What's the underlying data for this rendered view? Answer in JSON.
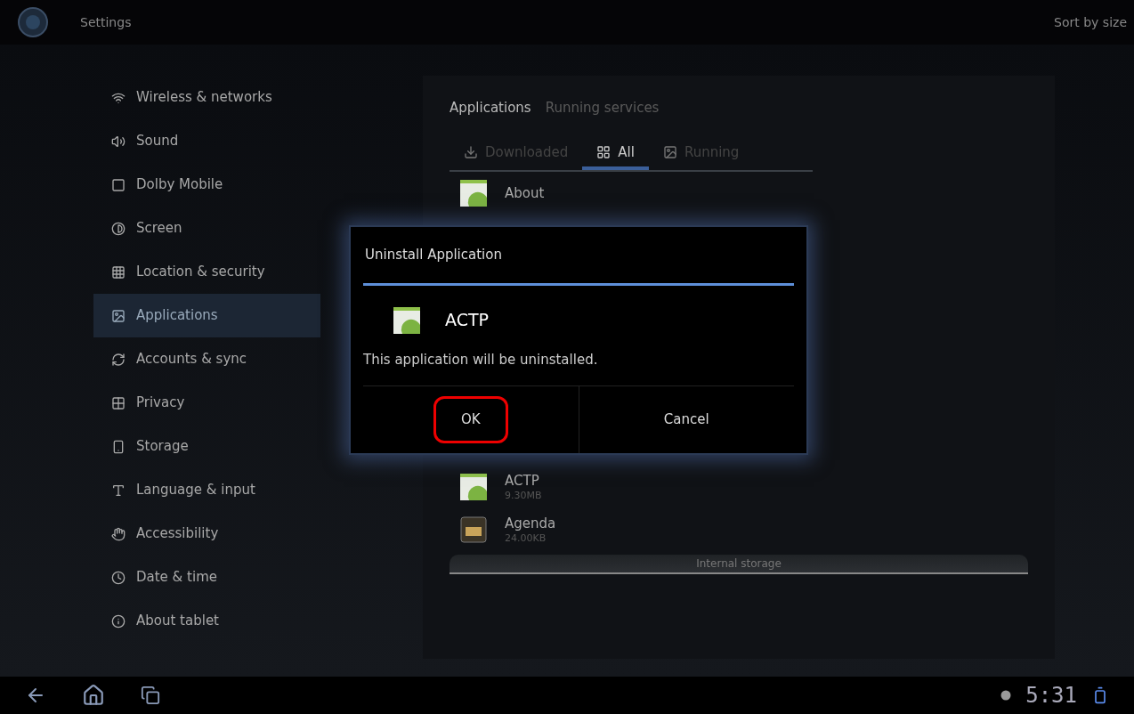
{
  "action_bar": {
    "title": "Settings",
    "action": "Sort by size"
  },
  "sidebar": {
    "items": [
      {
        "label": "Wireless & networks",
        "selected": false
      },
      {
        "label": "Sound",
        "selected": false
      },
      {
        "label": "Dolby Mobile",
        "selected": false
      },
      {
        "label": "Screen",
        "selected": false
      },
      {
        "label": "Location & security",
        "selected": false
      },
      {
        "label": "Applications",
        "selected": true
      },
      {
        "label": "Accounts & sync",
        "selected": false
      },
      {
        "label": "Privacy",
        "selected": false
      },
      {
        "label": "Storage",
        "selected": false
      },
      {
        "label": "Language & input",
        "selected": false
      },
      {
        "label": "Accessibility",
        "selected": false
      },
      {
        "label": "Date & time",
        "selected": false
      },
      {
        "label": "About tablet",
        "selected": false
      }
    ]
  },
  "header_tabs": [
    {
      "label": "Applications",
      "selected": true
    },
    {
      "label": "Running services",
      "selected": false
    }
  ],
  "filter_tabs": [
    {
      "label": "Downloaded",
      "selected": false
    },
    {
      "label": "All",
      "selected": true
    },
    {
      "label": "Running",
      "selected": false
    }
  ],
  "apps": [
    {
      "name": "About",
      "kind": "android"
    },
    {
      "name": "ACTP",
      "size": "9.30MB",
      "kind": "android"
    },
    {
      "name": "Agenda",
      "size": "24.00KB",
      "kind": "calendar"
    }
  ],
  "storage_label": "Internal storage",
  "dialog": {
    "title": "Uninstall Application",
    "app_name": "ACTP",
    "message": "This application will be uninstalled.",
    "buttons": [
      {
        "label": "OK",
        "highlighted": true
      },
      {
        "label": "Cancel",
        "highlighted": false
      }
    ]
  },
  "status_bar": {
    "time": "5:31"
  }
}
